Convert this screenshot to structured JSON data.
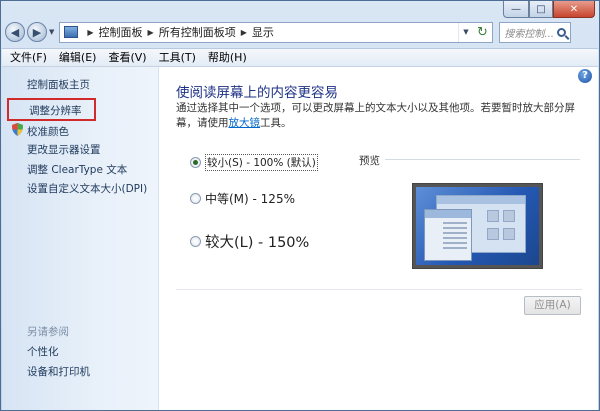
{
  "window": {
    "minimize_glyph": "—",
    "maximize_glyph": "□",
    "close_glyph": "✕"
  },
  "address": {
    "crumbs": [
      "控制面板",
      "所有控制面板项",
      "显示"
    ],
    "search_placeholder": "搜索控制..."
  },
  "menu": {
    "items": [
      "文件(F)",
      "编辑(E)",
      "查看(V)",
      "工具(T)",
      "帮助(H)"
    ]
  },
  "sidebar": {
    "home": "控制面板主页",
    "adjust_resolution": "调整分辨率",
    "calibrate_color": "校准颜色",
    "change_display_settings": "更改显示器设置",
    "cleartype": "调整 ClearType 文本",
    "custom_dpi": "设置自定义文本大小(DPI)",
    "see_also": "另请参阅",
    "personalization": "个性化",
    "devices_printers": "设备和打印机"
  },
  "main": {
    "title": "使阅读屏幕上的内容更容易",
    "description_prefix": "通过选择其中一个选项，可以更改屏幕上的文本大小以及其他项。若要暂时放大部分屏幕，请使用",
    "description_link": "放大镜",
    "description_suffix": "工具。",
    "options": [
      {
        "label": "较小(S) - 100% (默认)",
        "selected": true
      },
      {
        "label": "中等(M) - 125%",
        "selected": false
      },
      {
        "label": "较大(L) - 150%",
        "selected": false
      }
    ],
    "preview_label": "预览",
    "apply_label": "应用(A)",
    "help_glyph": "?"
  }
}
